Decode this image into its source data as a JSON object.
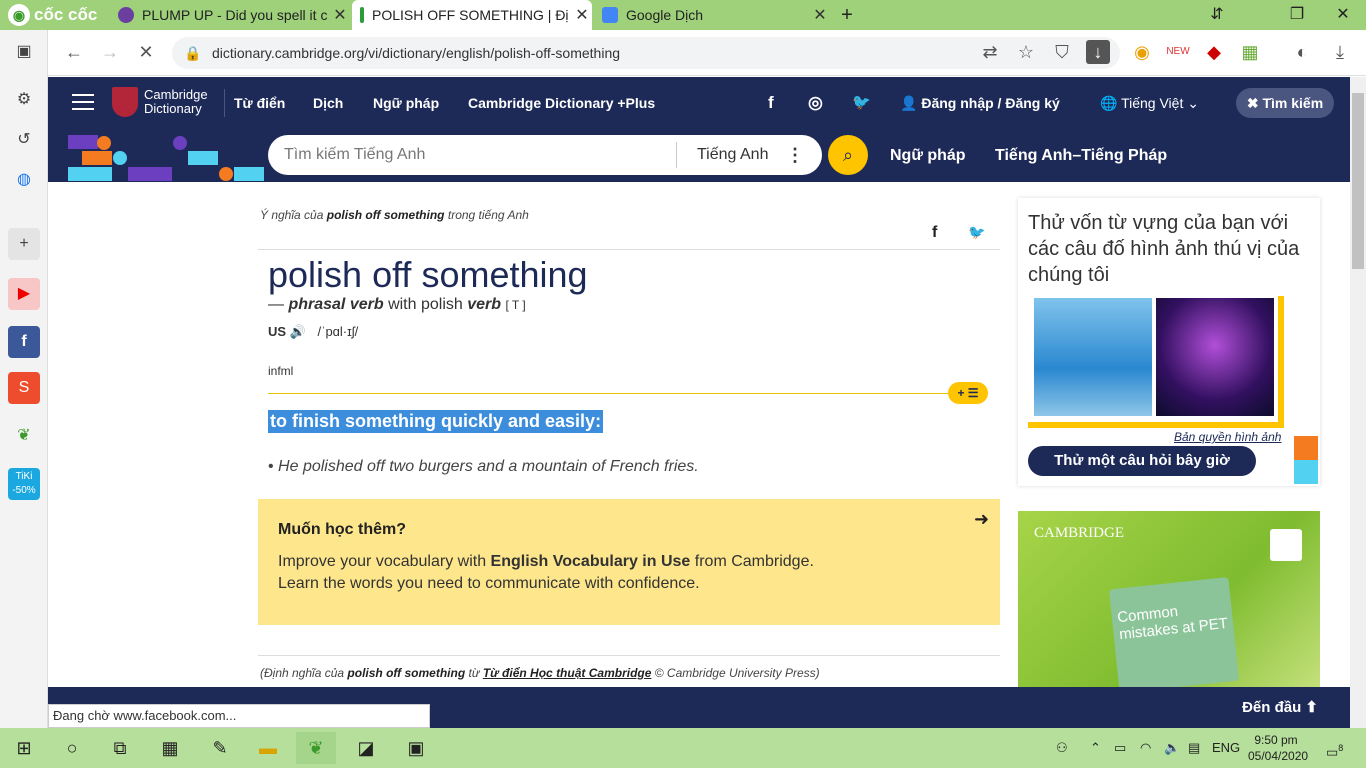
{
  "browser": {
    "brand": "cốc cốc",
    "tabs": [
      {
        "title": "PLUMP UP - Did you spell it c",
        "icon": "purple-circle-icon"
      },
      {
        "title": "POLISH OFF SOMETHING | Đị",
        "icon": "cambridge-icon"
      },
      {
        "title": "Google Dịch",
        "icon": "google-translate-icon"
      }
    ],
    "new_tab": "+",
    "url": "dictionary.cambridge.org/vi/dictionary/english/polish-off-something",
    "status": "Đang chờ www.facebook.com..."
  },
  "cambridge": {
    "brand_line1": "Cambridge",
    "brand_line2": "Dictionary",
    "nav": [
      "Từ điển",
      "Dịch",
      "Ngữ pháp",
      "Cambridge Dictionary +Plus"
    ],
    "login": "Đăng nhập / Đăng ký",
    "language": "Tiếng Việt",
    "search_toggle": "Tìm kiếm",
    "search_placeholder": "Tìm kiếm Tiếng Anh",
    "search_lang": "Tiếng Anh",
    "subnav": [
      "Ngữ pháp",
      "Tiếng Anh–Tiếng Pháp"
    ]
  },
  "entry": {
    "crumb_pre": "Ý nghĩa của",
    "crumb_word": "polish off something",
    "crumb_post": "trong tiếng Anh",
    "headword": "polish off something",
    "pos_dash": "—",
    "pos": "phrasal verb",
    "pos_with": "with polish",
    "pos_verb": "verb",
    "pos_code": "[ T ]",
    "region": "US",
    "ipa": "/ˈpɑl·ɪʃ/",
    "register": "infml",
    "definition": "to finish something quickly and easily:",
    "example": "He polished off two burgers and a mountain of French fries.",
    "promo_title": "Muốn học thêm?",
    "promo_line1_a": "Improve your vocabulary with",
    "promo_line1_b": "English Vocabulary in Use",
    "promo_line1_c": "from Cambridge.",
    "promo_line2": "Learn the words you need to communicate with confidence.",
    "source_pre": "(Định nghĩa của",
    "source_word": "polish off something",
    "source_from": "từ",
    "source_dict": "Từ điển Học thuật Cambridge",
    "source_post": "© Cambridge University Press)"
  },
  "quiz": {
    "title": "Thử vốn từ vựng của bạn với các câu đố hình ảnh thú vị của chúng tôi",
    "copyright": "Bản quyền hình ảnh",
    "button": "Thử một câu hỏi bây giờ"
  },
  "ad": {
    "brand": "CAMBRIDGE",
    "book_title": "Common mistakes at PET"
  },
  "bottom": {
    "to_top": "Đến đầu"
  },
  "taskbar": {
    "lang": "ENG",
    "time": "9:50 pm",
    "date": "05/04/2020",
    "notifications": "8"
  },
  "colors": {
    "cambridge_navy": "#1d2a57",
    "accent_yellow": "#fec400",
    "browser_green": "#9fd07a",
    "highlight_blue": "#3c8ddc"
  }
}
